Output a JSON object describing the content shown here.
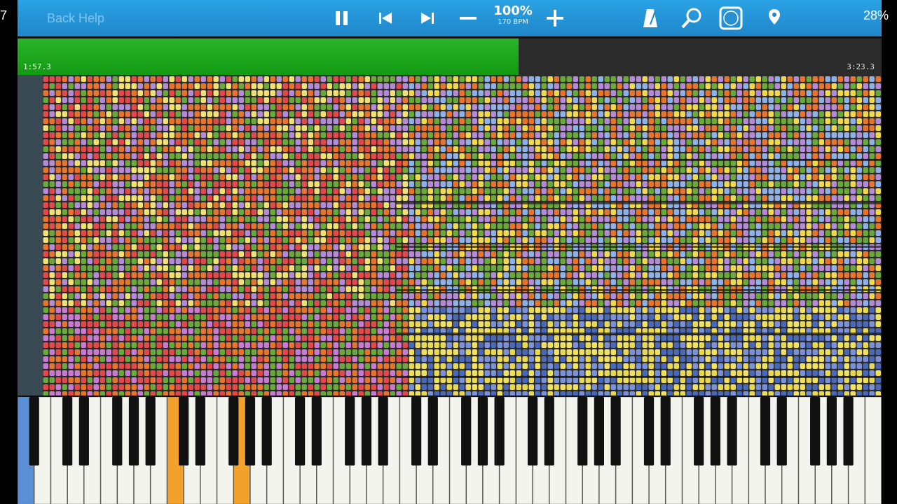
{
  "status_bar": {
    "left_text": "7",
    "battery": "28%"
  },
  "app_menu_label": "Back Help",
  "toolbar": {
    "speed_percent": "100%",
    "bpm": "170 BPM",
    "icons": [
      "pause-icon",
      "previous-icon",
      "next-icon",
      "speed-decrease-icon",
      "speed-increase-icon",
      "metronome-icon",
      "zoom-icon",
      "note-label-icon"
    ]
  },
  "progress": {
    "elapsed": "1:57.3",
    "total": "3:23.3",
    "fraction": 0.58
  },
  "colors": {
    "toolbar": "#2a9ee0",
    "progress_fill": "#1ea61e",
    "active_key": "#f2a12a",
    "blue_key": "#5a8fd6"
  }
}
